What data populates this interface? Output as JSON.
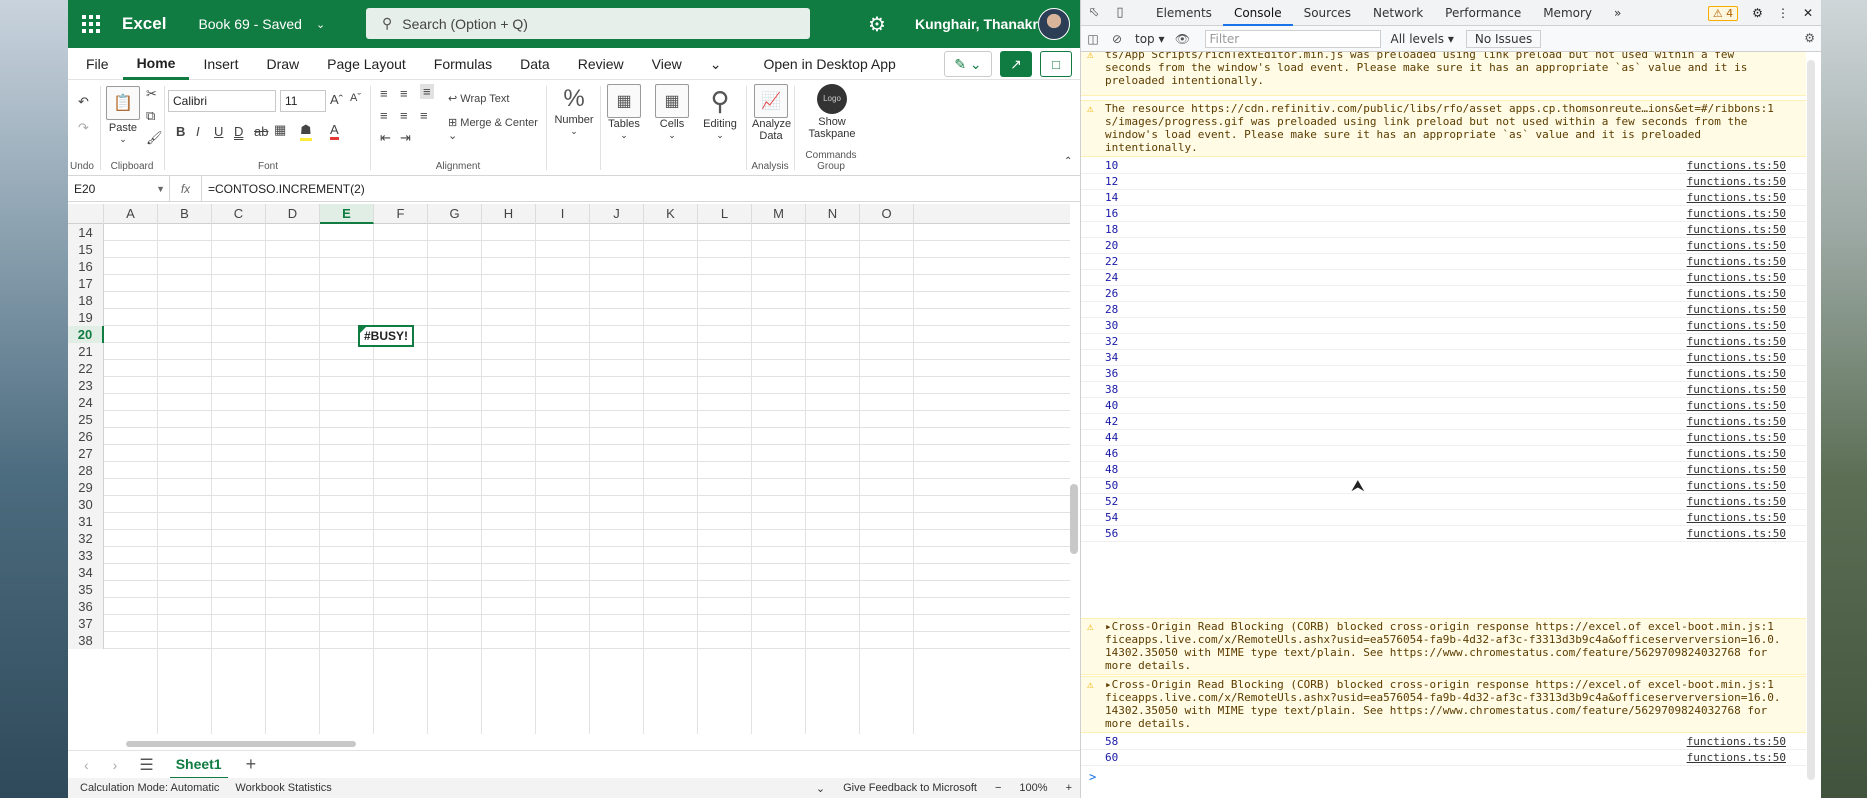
{
  "excel": {
    "app_name": "Excel",
    "doc_title": "Book 69 - Saved",
    "search_placeholder": "Search (Option + Q)",
    "user_name": "Kunghair, Thanakri...",
    "menu": [
      "File",
      "Home",
      "Insert",
      "Draw",
      "Page Layout",
      "Formulas",
      "Data",
      "Review",
      "View"
    ],
    "open_desktop": "Open in Desktop App",
    "ribbon": {
      "undo_label": "Undo",
      "paste_label": "Paste",
      "clipboard_label": "Clipboard",
      "font_name": "Calibri",
      "font_size": "11",
      "font_label": "Font",
      "wrap_text": "Wrap Text",
      "merge_center": "Merge & Center",
      "alignment_label": "Alignment",
      "number_label": "Number",
      "tables_label": "Tables",
      "cells_label": "Cells",
      "editing_label": "Editing",
      "analyze_label": "Analyze Data",
      "analysis_label": "Analysis",
      "taskpane_label": "Show Taskpane",
      "commands_label": "Commands Group",
      "logo_text": "Logo"
    },
    "name_box": "E20",
    "fx": "fx",
    "formula": "=CONTOSO.INCREMENT(2)",
    "columns": [
      "A",
      "B",
      "C",
      "D",
      "E",
      "F",
      "G",
      "H",
      "I",
      "J",
      "K",
      "L",
      "M",
      "N",
      "O"
    ],
    "selected_column": "E",
    "rows": [
      "14",
      "15",
      "16",
      "17",
      "18",
      "19",
      "20",
      "21",
      "22",
      "23",
      "24",
      "25",
      "26",
      "27",
      "28",
      "29",
      "30",
      "31",
      "32",
      "33",
      "34",
      "35",
      "36",
      "37",
      "38"
    ],
    "selected_row": "20",
    "active_cell_value": "#BUSY!",
    "sheet_tab": "Sheet1",
    "status": {
      "calc_mode": "Calculation Mode: Automatic",
      "stats": "Workbook Statistics",
      "feedback": "Give Feedback to Microsoft",
      "zoom": "100%"
    }
  },
  "devtools": {
    "tabs": [
      "Elements",
      "Console",
      "Sources",
      "Network",
      "Performance",
      "Memory"
    ],
    "active_tab": "Console",
    "warning_count": "4",
    "context": "top",
    "filter_placeholder": "Filter",
    "levels": "All levels",
    "issues": "No Issues",
    "warn1": "The resource https://cdn.excel-is.com/...Scripts/richTextEditor.min.js was preloaded using link preload but not used within a few seconds from the window's load event. Please make sure it has an appropriate `as` value and it is preloaded intentionally.",
    "warn1_lines": [
      "ts/App Scripts/richTextEditor.min.js was preloaded using link preload but not used within a few",
      "seconds from the window's load event. Please make sure it has an appropriate `as` value and it is",
      "preloaded intentionally."
    ],
    "warn2_lines": [
      "The resource https://cdn.refinitiv.com/public/libs/rfo/asset  apps.cp.thomsonreute…ions&et=#/ribbons:1",
      "s/images/progress.gif was preloaded using link preload but not used within a few seconds from the",
      "window's load event. Please make sure it has an appropriate `as` value and it is preloaded",
      "intentionally."
    ],
    "log_values": [
      "10",
      "12",
      "14",
      "16",
      "18",
      "20",
      "22",
      "24",
      "26",
      "28",
      "30",
      "32",
      "34",
      "36",
      "38",
      "40",
      "42",
      "44",
      "46",
      "48",
      "50",
      "52",
      "54",
      "56"
    ],
    "log_source": "functions.ts:50",
    "corb_lines": [
      "▸Cross-Origin Read Blocking (CORB) blocked cross-origin response https://excel.of  excel-boot.min.js:1",
      "ficeapps.live.com/x/RemoteUls.ashx?usid=ea576054-fa9b-4d32-af3c-f3313d3b9c4a&officeserverversion=16.0.",
      "14302.35050 with MIME type text/plain. See https://www.chromestatus.com/feature/5629709824032768 for",
      "more details."
    ],
    "log_values_after": [
      "58",
      "60"
    ],
    "prompt": ">"
  }
}
